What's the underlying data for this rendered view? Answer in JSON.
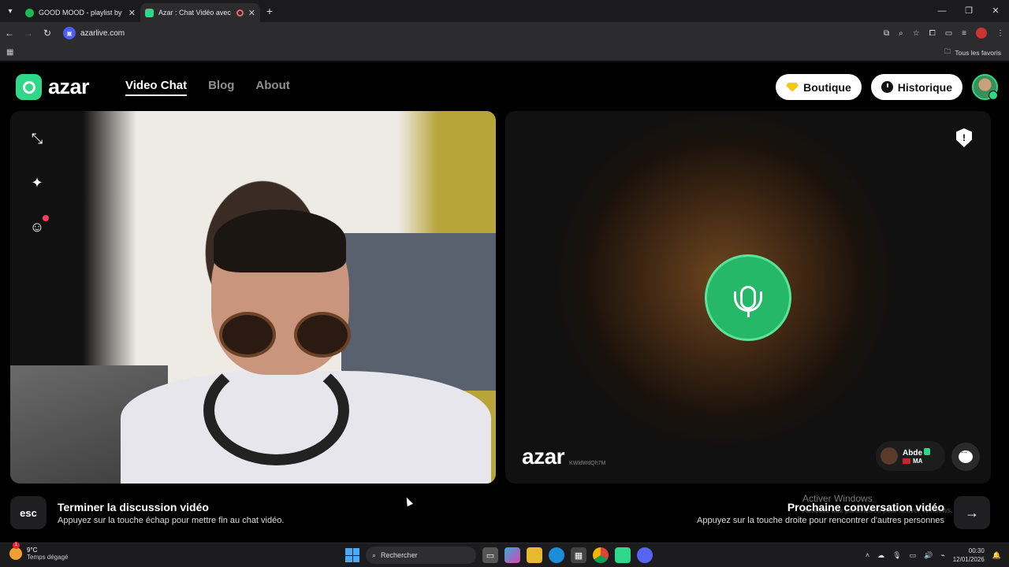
{
  "browser": {
    "tabs": [
      {
        "title": "GOOD MOOD - playlist by Csa",
        "favicon_color": "#1db954",
        "active": false
      },
      {
        "title": "Azar : Chat Vidéo avec de n",
        "favicon_color": "#2fd888",
        "active": true
      }
    ],
    "url": "azarlive.com",
    "bookmarks_label": "Tous les favoris"
  },
  "site": {
    "logo_text": "azar",
    "nav": [
      {
        "label": "Video Chat",
        "active": true
      },
      {
        "label": "Blog",
        "active": false
      },
      {
        "label": "About",
        "active": false
      }
    ],
    "shop_label": "Boutique",
    "history_label": "Historique",
    "accent_color": "#2fd888"
  },
  "remote_video": {
    "watermark": "azar",
    "watermark_id": "KWldWdQh7M",
    "partner_name": "Abde",
    "partner_country": "MA"
  },
  "hints": {
    "esc_key": "esc",
    "end_title": "Terminer la discussion vidéo",
    "end_sub": "Appuyez sur la touche échap pour mettre fin au chat vidéo.",
    "next_title": "Prochaine conversation vidéo",
    "next_sub": "Appuyez sur la touche droite pour rencontrer d'autres personnes"
  },
  "os_overlay": {
    "activate_title": "Activer Windows",
    "activate_sub": "Accédez aux paramètres pour activer Windows."
  },
  "taskbar": {
    "temperature": "9°C",
    "weather": "Temps dégagé",
    "search_placeholder": "Rechercher",
    "time": "00:30",
    "date": "12/01/2026"
  }
}
